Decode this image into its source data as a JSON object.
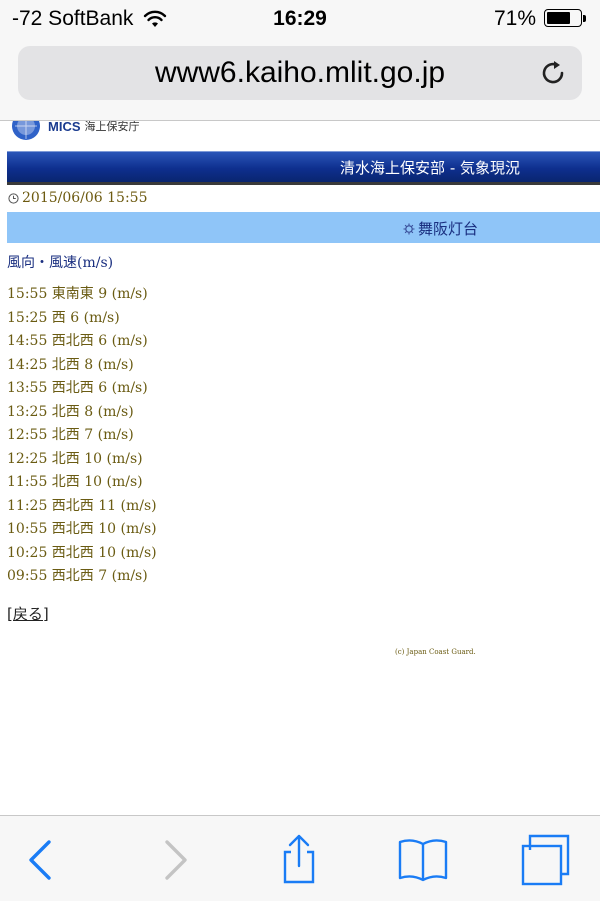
{
  "status_bar": {
    "carrier": "-72 SoftBank",
    "time": "16:29",
    "battery_percent": "71%",
    "battery_level": 0.71
  },
  "url_bar": {
    "url": "www6.kaiho.mlit.go.jp"
  },
  "page": {
    "logo": {
      "mics": "MICS",
      "org": "海上保安庁"
    },
    "header_title": "清水海上保安部 - 気象現況",
    "datetime": "2015/06/06 15:55",
    "station": "舞阪灯台",
    "section_title": "風向・風速(m/s)",
    "readings": [
      "15:55 東南東 9 (m/s)",
      "15:25 西 6 (m/s)",
      "14:55 西北西 6 (m/s)",
      "14:25 北西 8 (m/s)",
      "13:55 西北西 6 (m/s)",
      "13:25 北西 8 (m/s)",
      "12:55 北西 7 (m/s)",
      "12:25 北西 10 (m/s)",
      "11:55 北西 10 (m/s)",
      "11:25 西北西 11 (m/s)",
      "10:55 西北西 10 (m/s)",
      "10:25 西北西 10 (m/s)",
      "09:55 西北西 7 (m/s)"
    ],
    "back_link": "[戻る]",
    "copyright": "(c) Japan Coast Guard."
  },
  "colors": {
    "header_blue": "#0e2f8e",
    "station_bar": "#8fc5f8",
    "reading_text": "#6a5b12",
    "ios_blue": "#1a7cf5"
  },
  "icons": {
    "wifi": "wifi-icon",
    "battery": "battery-icon",
    "reload": "reload-icon",
    "clock": "clock-icon",
    "gear": "gear-icon",
    "back": "chevron-left-icon",
    "forward": "chevron-right-icon",
    "share": "share-icon",
    "bookmarks": "book-icon",
    "tabs": "tabs-icon"
  }
}
